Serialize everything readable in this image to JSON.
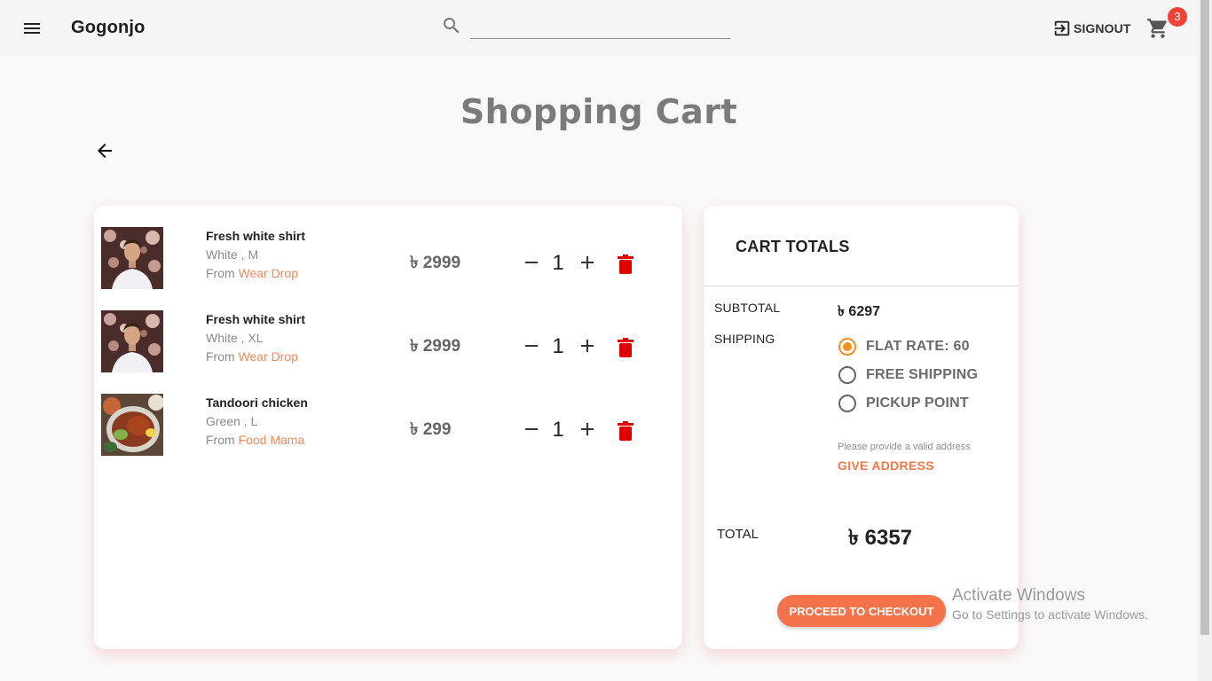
{
  "header": {
    "brand": "Gogonjo",
    "search_value": "",
    "signout_label": "SIGNOUT",
    "cart_count": "3"
  },
  "page": {
    "title": "Shopping Cart"
  },
  "cart": {
    "items": [
      {
        "name": "Fresh white shirt",
        "variant": "White , M",
        "from_label": "From",
        "shop": "Wear Drop",
        "price": "৳ 2999",
        "qty": "1",
        "image": "person-white-shirt"
      },
      {
        "name": "Fresh white shirt",
        "variant": "White , XL",
        "from_label": "From",
        "shop": "Wear Drop",
        "price": "৳ 2999",
        "qty": "1",
        "image": "person-white-shirt"
      },
      {
        "name": "Tandoori chicken",
        "variant": "Green , L",
        "from_label": "From",
        "shop": "Food Mama",
        "price": "৳ 299",
        "qty": "1",
        "image": "tandoori-chicken-plate"
      }
    ]
  },
  "totals": {
    "title": "CART TOTALS",
    "subtotal_label": "SUBTOTAL",
    "subtotal_value": "৳ 6297",
    "shipping_label": "SHIPPING",
    "shipping_options": [
      {
        "label": "FLAT RATE: 60",
        "selected": true
      },
      {
        "label": "FREE SHIPPING",
        "selected": false
      },
      {
        "label": "PICKUP POINT",
        "selected": false
      }
    ],
    "address_note": "Please provide a valid address",
    "give_address_label": "GIVE ADDRESS",
    "total_label": "TOTAL",
    "total_value": "৳ 6357",
    "checkout_label": "PROCEED TO CHECKOUT"
  },
  "watermark": {
    "title": "Activate Windows",
    "subtitle": "Go to Settings to activate Windows."
  },
  "colors": {
    "accent": "#f5734a",
    "radio_selected": "#f5901e",
    "delete_icon": "#e00000",
    "badge": "#f44336",
    "shop_link": "#f58a5a"
  },
  "icons": [
    "menu-icon",
    "search-icon",
    "signout-icon",
    "cart-icon",
    "back-arrow-icon",
    "minus-icon",
    "plus-icon",
    "trash-icon"
  ]
}
